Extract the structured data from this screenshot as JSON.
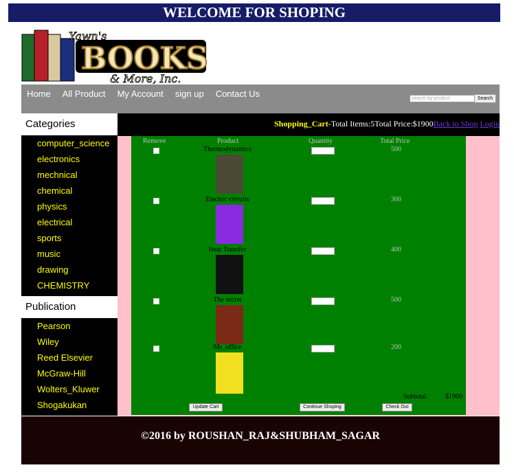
{
  "banner": "WELCOME FOR SHOPING",
  "nav": {
    "links": [
      "Home",
      "All Product",
      "My Account",
      "sign up",
      "Contact Us"
    ],
    "search_placeholder": "search by product",
    "search_button": "Search"
  },
  "sidebar": {
    "categories_title": "Categories",
    "categories": [
      "computer_science",
      "electronics",
      "mechnical",
      "chemical",
      "physics",
      "electrical",
      "sports",
      "music",
      "drawing",
      "CHEMISTRY"
    ],
    "publication_title": "Publication",
    "publications": [
      "Pearson",
      "Wiley",
      "Reed Elsevier",
      "McGraw-Hill",
      "Wolters_Kluwer",
      "Shogakukan"
    ]
  },
  "cart": {
    "title": "Shopping_Cart",
    "summary": "-Total Items:5Total Price:$1900",
    "back_link": "Back to Shop",
    "login_link": "Login",
    "headers": {
      "remove": "Remove",
      "product": "Product",
      "quantity": "Quantity",
      "total": "Total Price"
    },
    "items": [
      {
        "name": "Thermodynamics",
        "price": "500",
        "cover": "#4a4a34"
      },
      {
        "name": "Electric circuits",
        "price": "300",
        "cover": "#8a2be2"
      },
      {
        "name": "Heat Transfer",
        "price": "400",
        "cover": "#111111"
      },
      {
        "name": "The secret",
        "price": "500",
        "cover": "#7a2a16"
      },
      {
        "name": "Ms_office",
        "price": "200",
        "cover": "#f0e020"
      }
    ],
    "subtotal_label": "Subtotal",
    "subtotal_value": "$1900",
    "buttons": {
      "update": "Update Cart",
      "continue": "Continue Shoping",
      "checkout": "Check Out"
    }
  },
  "footer": "©2016 by ROUSHAN_RAJ&SHUBHAM_SAGAR"
}
